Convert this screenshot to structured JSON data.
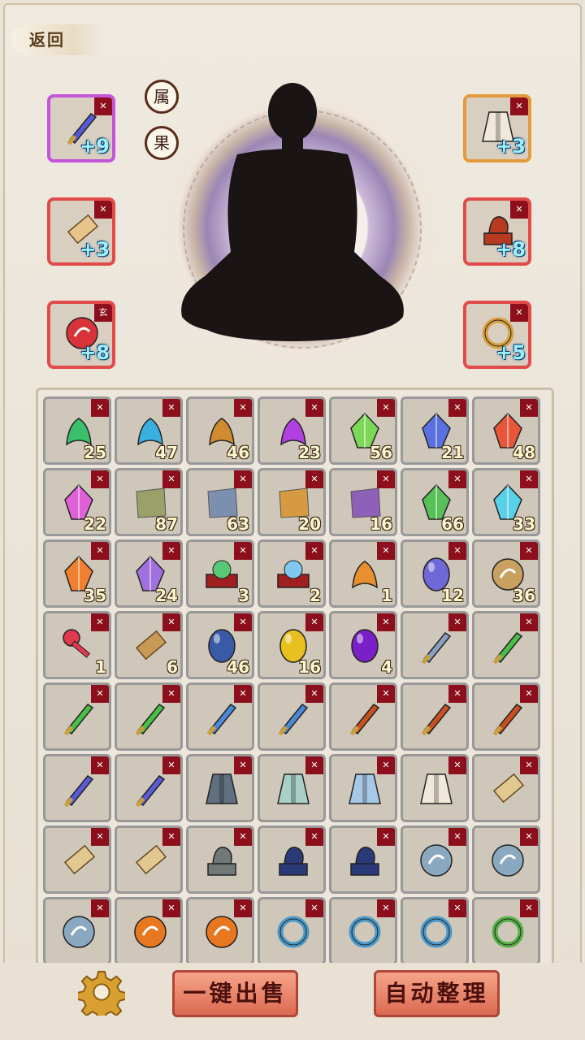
{
  "back_label": "返回",
  "tags": [
    "属",
    "果"
  ],
  "equipment": [
    {
      "slot": "weapon",
      "level": "+9",
      "quality": "purple",
      "icon": "purple-sword-icon",
      "tag": "bind",
      "side": "left",
      "row": 0,
      "color": "#5a5ad8"
    },
    {
      "slot": "scroll",
      "level": "+3",
      "quality": "red",
      "icon": "scroll-icon",
      "tag": "bind",
      "side": "left",
      "row": 1,
      "color": "#e6c48a"
    },
    {
      "slot": "amulet",
      "level": "+8",
      "quality": "red",
      "icon": "red-amulet-icon",
      "tag": "玄",
      "side": "left",
      "row": 2,
      "color": "#d8323a"
    },
    {
      "slot": "robe",
      "level": "+3",
      "quality": "orange",
      "icon": "white-robe-icon",
      "tag": "bind",
      "side": "right",
      "row": 0,
      "color": "#f0e8d8"
    },
    {
      "slot": "statue",
      "level": "+8",
      "quality": "red",
      "icon": "dragon-seal-icon",
      "tag": "bind",
      "side": "right",
      "row": 1,
      "color": "#b83a20"
    },
    {
      "slot": "ring",
      "level": "+5",
      "quality": "red",
      "icon": "gold-ring-icon",
      "tag": "bind",
      "side": "right",
      "row": 2,
      "color": "#d8a040"
    }
  ],
  "bag_items": [
    {
      "name": "green-coral-icon",
      "qty": "25",
      "q": "green",
      "c": "#3bbf6a"
    },
    {
      "name": "blue-flower-icon",
      "qty": "47",
      "q": "blue",
      "c": "#3ab0e0"
    },
    {
      "name": "ginseng-root-icon",
      "qty": "46",
      "q": "orange",
      "c": "#d08a30"
    },
    {
      "name": "purple-jellyfish-icon",
      "qty": "23",
      "q": "purple",
      "c": "#b040e0"
    },
    {
      "name": "green-crystal-icon",
      "qty": "56",
      "q": "green",
      "c": "#7ed858"
    },
    {
      "name": "blue-crystal-icon",
      "qty": "21",
      "q": "blue",
      "c": "#5a70e0"
    },
    {
      "name": "red-crystal-icon",
      "qty": "48",
      "q": "orange",
      "c": "#e8553a"
    },
    {
      "name": "pink-crystal-icon",
      "qty": "22",
      "q": "purple",
      "c": "#e060d8"
    },
    {
      "name": "green-cloth-icon",
      "qty": "87",
      "q": "green",
      "c": "#9aa068"
    },
    {
      "name": "blue-cloth-icon",
      "qty": "63",
      "q": "blue",
      "c": "#7c8fae"
    },
    {
      "name": "orange-cloth-icon",
      "qty": "20",
      "q": "orange",
      "c": "#d89a40"
    },
    {
      "name": "purple-cloth-icon",
      "qty": "16",
      "q": "purple",
      "c": "#8e60b8"
    },
    {
      "name": "green-leaf-gem-icon",
      "qty": "66",
      "q": "green",
      "c": "#58c058"
    },
    {
      "name": "ice-crystal-icon",
      "qty": "33",
      "q": "blue",
      "c": "#58d0e8"
    },
    {
      "name": "fire-crystal-icon",
      "qty": "35",
      "q": "orange",
      "c": "#f08030"
    },
    {
      "name": "violet-crystal-icon",
      "qty": "24",
      "q": "purple",
      "c": "#a070e0"
    },
    {
      "name": "green-orb-box-icon",
      "qty": "3",
      "q": "green",
      "c": "#58c878"
    },
    {
      "name": "blue-orb-box-icon",
      "qty": "2",
      "q": "blue",
      "c": "#80c8f0"
    },
    {
      "name": "phoenix-feather-icon",
      "qty": "1",
      "q": "red",
      "c": "#e89030"
    },
    {
      "name": "blue-stone-icon",
      "qty": "12",
      "q": "purple",
      "c": "#6e68d8"
    },
    {
      "name": "jade-disc-icon",
      "qty": "36",
      "q": "red",
      "c": "#c8a060"
    },
    {
      "name": "red-key-icon",
      "qty": "1",
      "q": "red",
      "c": "#e03850"
    },
    {
      "name": "bundle-scroll-icon",
      "qty": "6",
      "q": "purple",
      "c": "#c89a58"
    },
    {
      "name": "blue-egg-icon",
      "qty": "46",
      "q": "blue",
      "c": "#3a5aa8"
    },
    {
      "name": "gold-egg-icon",
      "qty": "16",
      "q": "orange",
      "c": "#e8c020"
    },
    {
      "name": "purple-egg-icon",
      "qty": "4",
      "q": "purple",
      "c": "#7a20c8"
    },
    {
      "name": "grey-sword-icon",
      "qty": "",
      "q": "grey",
      "c": "#8aa0c0"
    },
    {
      "name": "green-sword-icon",
      "qty": "",
      "q": "green",
      "c": "#48c048"
    },
    {
      "name": "green-sword-icon",
      "qty": "",
      "q": "green",
      "c": "#48c048"
    },
    {
      "name": "green-sword-icon",
      "qty": "",
      "q": "green",
      "c": "#48c048"
    },
    {
      "name": "blue-sword-icon",
      "qty": "",
      "q": "blue",
      "c": "#4a88d8"
    },
    {
      "name": "blue-sword-icon",
      "qty": "",
      "q": "blue",
      "c": "#4a88d8"
    },
    {
      "name": "gold-sword-icon",
      "qty": "",
      "q": "orange",
      "c": "#c85020"
    },
    {
      "name": "gold-sword-icon",
      "qty": "",
      "q": "orange",
      "c": "#c85020"
    },
    {
      "name": "gold-sword-icon",
      "qty": "",
      "q": "orange",
      "c": "#c85020"
    },
    {
      "name": "purple-sword-icon",
      "qty": "",
      "q": "purple",
      "c": "#5a5ad8"
    },
    {
      "name": "purple-sword-icon",
      "qty": "",
      "q": "purple",
      "c": "#5a5ad8"
    },
    {
      "name": "grey-robe-icon",
      "qty": "",
      "q": "grey",
      "c": "#607080"
    },
    {
      "name": "green-robe-icon",
      "qty": "",
      "q": "green",
      "c": "#a8d0c8"
    },
    {
      "name": "blue-robe-icon",
      "qty": "",
      "q": "blue",
      "c": "#a8c8e8"
    },
    {
      "name": "white-robe-icon",
      "qty": "",
      "q": "orange",
      "c": "#f0e8d8"
    },
    {
      "name": "grey-scroll-icon",
      "qty": "",
      "q": "grey",
      "c": "#e0c890"
    },
    {
      "name": "blue-scroll-icon",
      "qty": "",
      "q": "blue",
      "c": "#e0c890"
    },
    {
      "name": "orange-scroll-icon",
      "qty": "",
      "q": "orange",
      "c": "#e0c890"
    },
    {
      "name": "grey-statue-icon",
      "qty": "",
      "q": "grey",
      "c": "#707878"
    },
    {
      "name": "blue-dragon-seal-icon",
      "qty": "",
      "q": "blue",
      "c": "#2a3a78"
    },
    {
      "name": "blue-dragon-seal-icon",
      "qty": "",
      "q": "blue",
      "c": "#2a3a78"
    },
    {
      "name": "grey-amulet-icon",
      "qty": "",
      "q": "grey",
      "c": "#8aa8c0"
    },
    {
      "name": "grey-amulet-icon",
      "qty": "",
      "q": "grey",
      "c": "#8aa8c0"
    },
    {
      "name": "grey-amulet-icon",
      "qty": "",
      "q": "grey",
      "c": "#8aa8c0"
    },
    {
      "name": "orange-amulet-icon",
      "qty": "",
      "q": "orange",
      "c": "#e87820"
    },
    {
      "name": "orange-amulet-icon",
      "qty": "",
      "q": "orange",
      "c": "#e87820"
    },
    {
      "name": "grey-ring-icon",
      "qty": "",
      "q": "grey",
      "c": "#4a98c8"
    },
    {
      "name": "grey-ring-icon",
      "qty": "",
      "q": "grey",
      "c": "#4a98c8"
    },
    {
      "name": "grey-ring-icon",
      "qty": "",
      "q": "grey",
      "c": "#4a98c8"
    },
    {
      "name": "green-ring-icon",
      "qty": "",
      "q": "green",
      "c": "#58b048"
    }
  ],
  "buttons": {
    "sell_all": "一键出售",
    "auto_sort": "自动整理"
  }
}
